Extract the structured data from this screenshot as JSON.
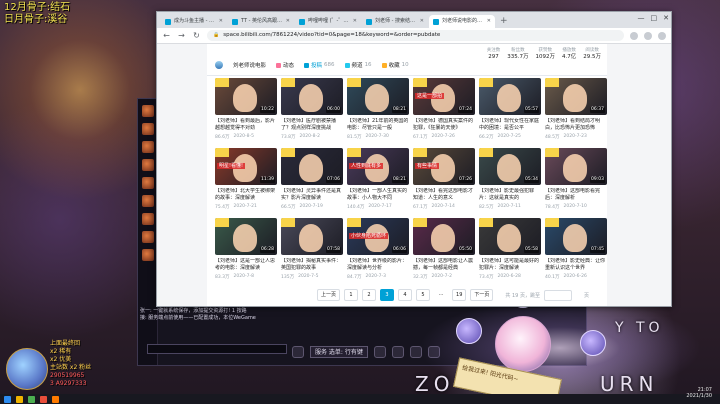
{
  "overlay": {
    "title_line1": "12月骨子:结石",
    "title_line2": "日月骨子:溪谷"
  },
  "left_panel": {
    "lines": [
      "上面最终回",
      "x2 稀有",
      "x2 优美",
      "主站数 x2 粉丝",
      "290519965",
      "3 A9297333"
    ]
  },
  "game_client": {
    "chat_lines": [
      "张一: 一键就系统保存，添加提交资源打! 1 按路",
      "接: 服务端点前使用——已配置成功，本位WeGame"
    ],
    "mode_select": "服务 选单: 行有键",
    "gc_ready_label": "已"
  },
  "browser": {
    "tabs": [
      {
        "label": "成为斗鱼主播 - 斗鱼",
        "active": false
      },
      {
        "label": "TT - 英伦风高跟_按增新星图...",
        "active": false
      },
      {
        "label": "哔哩哔哩 (゜-゜)つロ 干杯~-bi...",
        "active": false
      },
      {
        "label": "刘老师 - 搜索结果 - 哔哩哔哩...",
        "active": false
      },
      {
        "label": "刘老师说电影的个人空间 - 哔哩...",
        "active": true
      }
    ],
    "new_tab": "+",
    "window_controls": [
      "—",
      "□",
      "✕"
    ],
    "url": "space.bilibili.com/7861224/video?tid=0&page=18&keyword=&order=pubdate",
    "lock_icon": "🔒",
    "nav_back": "←",
    "nav_forward": "→",
    "nav_reload": "↻"
  },
  "space": {
    "owner_name": "刘老师说电影",
    "nav": [
      {
        "label": "动态",
        "count": ""
      },
      {
        "label": "投稿",
        "count": "686"
      },
      {
        "label": "频道",
        "count": "16"
      },
      {
        "label": "收藏",
        "count": "10"
      }
    ],
    "stats": [
      {
        "label": "关注数",
        "value": "297"
      },
      {
        "label": "粉丝数",
        "value": "335.7万"
      },
      {
        "label": "获赞数",
        "value": "1092万"
      },
      {
        "label": "播放数",
        "value": "4.7亿"
      },
      {
        "label": "阅读数",
        "value": "29.5万"
      }
    ]
  },
  "videos": [
    [
      {
        "title": "【刘老师】看到最后，影片越想越觉得不对劲",
        "duration": "10:22",
        "views": "86.6万",
        "date": "2020-8-5",
        "banner": "",
        "tone": "#6b4a3a"
      },
      {
        "title": "【刘老师】医疗剧被禁播了？观点别样深度挑战",
        "duration": "06:00",
        "views": "73.8万",
        "date": "2020-8-2",
        "banner": "",
        "tone": "#3a3a4e"
      },
      {
        "title": "【刘老师】21年前的英国的电影：尽管只是一般",
        "duration": "08:21",
        "views": "81.5万",
        "date": "2020-7-30",
        "banner": "",
        "tone": "#2f4a5a"
      },
      {
        "title": "【刘老师】德国真实案件的犯罪，《狂暴的天使》",
        "duration": "07:24",
        "views": "67.1万",
        "date": "2020-7-26",
        "banner": "这是一部拍",
        "tone": "#5a3a3a"
      },
      {
        "title": "【刘老师】现代女性在家庭中的困境：是否公平",
        "duration": "05:57",
        "views": "66.2万",
        "date": "2020-7-25",
        "banner": "",
        "tone": "#4a5a6a"
      },
      {
        "title": "【刘老师】看到结局才明白，比恐怖片更加恐怖",
        "duration": "06:37",
        "views": "48.5万",
        "date": "2020-7-23",
        "banner": "",
        "tone": "#6a5a4a"
      }
    ],
    [
      {
        "title": "【刘老师】北大学生被绑架的故事：深度解读",
        "duration": "11:39",
        "views": "75.4万",
        "date": "2020-7-21",
        "banner": "明星!看懂!",
        "tone": "#8a3a2a"
      },
      {
        "title": "【刘老师】灵异事件还是真实？影片深度解读",
        "duration": "07:06",
        "views": "66.5万",
        "date": "2020-7-19",
        "banner": "",
        "tone": "#2a2a3a"
      },
      {
        "title": "【刘老师】一部人生真实的故事：小人物大不同",
        "duration": "08:21",
        "views": "140.4万",
        "date": "2020-7-17",
        "banner": "人性到底有多",
        "tone": "#4a3a5a"
      },
      {
        "title": "【刘老师】看完这部电影才知道：人生的意义",
        "duration": "07:26",
        "views": "67.1万",
        "date": "2020-7-14",
        "banner": "有些事情",
        "tone": "#5a4a3a"
      },
      {
        "title": "【刘老师】影史最强犯罪片：这就是真实的",
        "duration": "05:34",
        "views": "82.5万",
        "date": "2020-7-11",
        "banner": "",
        "tone": "#3a4a4a"
      },
      {
        "title": "【刘老师】这部电影看完后：深度解析",
        "duration": "09:03",
        "views": "78.4万",
        "date": "2020-7-10",
        "banner": "",
        "tone": "#6a4a5a"
      }
    ],
    [
      {
        "title": "【刘老师】这是一部让人思考的电影：深度解读",
        "duration": "06:28",
        "views": "83.3万",
        "date": "2020-7-8",
        "banner": "",
        "tone": "#3a5a4a"
      },
      {
        "title": "【刘老师】揭秘真实事件：英国犯罪的故事",
        "duration": "07:58",
        "views": "135万",
        "date": "2020-7-5",
        "banner": "",
        "tone": "#4a4a5a"
      },
      {
        "title": "【刘老师】世界级的影片：深度解读与分析",
        "duration": "06:06",
        "views": "84.7万",
        "date": "2020-7-3",
        "banner": "小伙身陷死循环",
        "tone": "#2a3a5a"
      },
      {
        "title": "【刘老师】这部电影让人震撼，每一帧都是经典",
        "duration": "05:50",
        "views": "32.3万",
        "date": "2020-7-2",
        "banner": "",
        "tone": "#5a2a4a"
      },
      {
        "title": "【刘老师】这可能是最好的犯罪片：深度解读",
        "duration": "05:58",
        "views": "73.4万",
        "date": "2020-6-28",
        "banner": "",
        "tone": "#3a3a3a"
      },
      {
        "title": "【刘老师】影史经典：让你重新认识这个世界",
        "duration": "07:45",
        "views": "40.1万",
        "date": "2020-6-26",
        "banner": "",
        "tone": "#2a4a6a"
      }
    ]
  ],
  "pagination": {
    "prev": "上一页",
    "pages": [
      "1",
      "2",
      "3",
      "4",
      "5",
      "...",
      "19"
    ],
    "current": "3",
    "next": "下一页",
    "jump_label": "共 19 页，跳至",
    "jump_suffix": "页"
  },
  "deco": {
    "tag_line": "Y TO",
    "big_left": "ZO",
    "big_right": "URN",
    "sign_text": "给我过来! 阳光代码~"
  },
  "taskbar": {
    "time": "21:07",
    "date": "2021/1/30"
  },
  "colors": {
    "accent": "#00a1d6",
    "stream_yellow": "#f0e050"
  }
}
